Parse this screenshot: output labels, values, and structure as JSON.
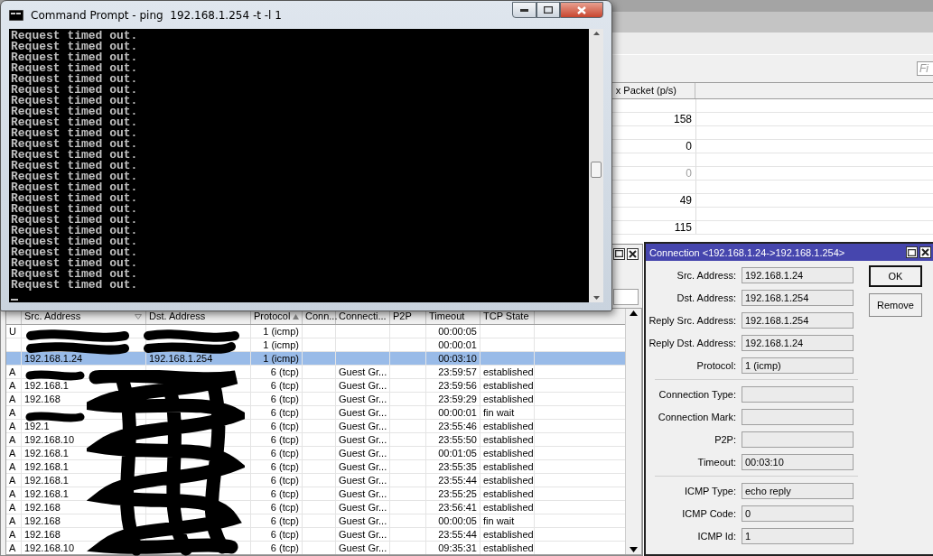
{
  "back_window": {
    "find": {
      "placeholder": "Fi"
    },
    "column_header": "x Packet (p/s)",
    "rows": [
      {
        "value": "158",
        "disabled": false
      },
      {
        "value": "0",
        "disabled": false
      },
      {
        "value": "0",
        "disabled": true
      },
      {
        "value": "49",
        "disabled": false
      },
      {
        "value": "115",
        "disabled": false
      }
    ]
  },
  "connections_window": {
    "columns": [
      "Src. Address",
      "Dst. Address",
      "Protocol",
      "Conn...",
      "Connecti...",
      "P2P",
      "Timeout",
      "TCP State"
    ],
    "rows": [
      {
        "flag": "U",
        "protocol": "1 (icmp)",
        "timeout": "00:00:05",
        "selected": false
      },
      {
        "protocol": "1 (icmp)",
        "timeout": "00:00:01",
        "selected": false
      },
      {
        "src": "192.168.1.24",
        "dst": "192.168.1.254",
        "protocol": "1 (icmp)",
        "timeout": "00:03:10",
        "selected": true
      },
      {
        "flag": "A",
        "protocol": "6 (tcp)",
        "mark": "Guest Gr...",
        "timeout": "23:59:57",
        "state": "established",
        "selected": false
      },
      {
        "flag": "A",
        "src": "192.168.1",
        "protocol": "6 (tcp)",
        "mark": "Guest Gr...",
        "timeout": "23:59:56",
        "state": "established",
        "selected": false
      },
      {
        "flag": "A",
        "src": "192.168",
        "protocol": "6 (tcp)",
        "mark": "Guest Gr...",
        "timeout": "23:59:29",
        "state": "established",
        "selected": false
      },
      {
        "flag": "A",
        "protocol": "6 (tcp)",
        "mark": "Guest Gr...",
        "timeout": "00:00:01",
        "state": "fin wait",
        "selected": false
      },
      {
        "flag": "A",
        "src": "192.1",
        "protocol": "6 (tcp)",
        "mark": "Guest Gr...",
        "timeout": "23:55:46",
        "state": "established",
        "selected": false
      },
      {
        "flag": "A",
        "src": "192.168.10",
        "protocol": "6 (tcp)",
        "mark": "Guest Gr...",
        "timeout": "23:55:50",
        "state": "established",
        "selected": false
      },
      {
        "flag": "A",
        "src": "192.168.1",
        "protocol": "6 (tcp)",
        "mark": "Guest Gr...",
        "timeout": "00:01:05",
        "state": "established",
        "selected": false
      },
      {
        "flag": "A",
        "src": "192.168.1",
        "protocol": "6 (tcp)",
        "mark": "Guest Gr...",
        "timeout": "23:55:35",
        "state": "established",
        "selected": false
      },
      {
        "flag": "A",
        "src": "192.168.1",
        "protocol": "6 (tcp)",
        "mark": "Guest Gr...",
        "timeout": "23:55:44",
        "state": "established",
        "selected": false
      },
      {
        "flag": "A",
        "src": "192.168.1",
        "protocol": "6 (tcp)",
        "mark": "Guest Gr...",
        "timeout": "23:55:25",
        "state": "established",
        "selected": false
      },
      {
        "flag": "A",
        "src": "192.168",
        "protocol": "6 (tcp)",
        "mark": "Guest Gr...",
        "timeout": "23:56:41",
        "state": "established",
        "selected": false
      },
      {
        "flag": "A",
        "src": "192.168",
        "protocol": "6 (tcp)",
        "mark": "Guest Gr...",
        "timeout": "00:00:05",
        "state": "fin wait",
        "selected": false
      },
      {
        "flag": "A",
        "src": "192.168",
        "protocol": "6 (tcp)",
        "mark": "Guest Gr...",
        "timeout": "23:55:44",
        "state": "established",
        "selected": false
      },
      {
        "flag": "A",
        "src": "192.168.10",
        "protocol": "6 (tcp)",
        "mark": "Guest Gr...",
        "timeout": "09:35:31",
        "state": "established",
        "selected": false
      }
    ]
  },
  "console_window": {
    "title": "Command Prompt - ping  192.168.1.254 -t -l 1",
    "lines": [
      "Request timed out.",
      "Request timed out.",
      "Request timed out.",
      "Request timed out.",
      "Request timed out.",
      "Request timed out.",
      "Request timed out.",
      "Request timed out.",
      "Request timed out.",
      "Request timed out.",
      "Request timed out.",
      "Request timed out.",
      "Request timed out.",
      "Request timed out.",
      "Request timed out.",
      "Request timed out.",
      "Request timed out.",
      "Request timed out.",
      "Request timed out.",
      "Request timed out.",
      "Request timed out.",
      "Request timed out.",
      "Request timed out.",
      "Request timed out."
    ]
  },
  "connection_dialog": {
    "title": "Connection <192.168.1.24->192.168.1.254>",
    "groups": [
      [
        {
          "label": "Src. Address:",
          "value": "192.168.1.24"
        },
        {
          "label": "Dst. Address:",
          "value": "192.168.1.254"
        },
        {
          "label": "Reply Src. Address:",
          "value": "192.168.1.254"
        },
        {
          "label": "Reply Dst. Address:",
          "value": "192.168.1.24"
        },
        {
          "label": "Protocol:",
          "value": "1 (icmp)"
        }
      ],
      [
        {
          "label": "Connection Type:"
        },
        {
          "label": "Connection Mark:"
        },
        {
          "label": "P2P:"
        },
        {
          "label": "Timeout:",
          "value": "00:03:10"
        }
      ],
      [
        {
          "label": "ICMP Type:",
          "value": "echo reply"
        },
        {
          "label": "ICMP Code:",
          "value": "0"
        },
        {
          "label": "ICMP Id:",
          "value": "1"
        }
      ]
    ],
    "buttons": [
      {
        "label": "OK",
        "default": true
      },
      {
        "label": "Remove",
        "default": false
      }
    ]
  }
}
